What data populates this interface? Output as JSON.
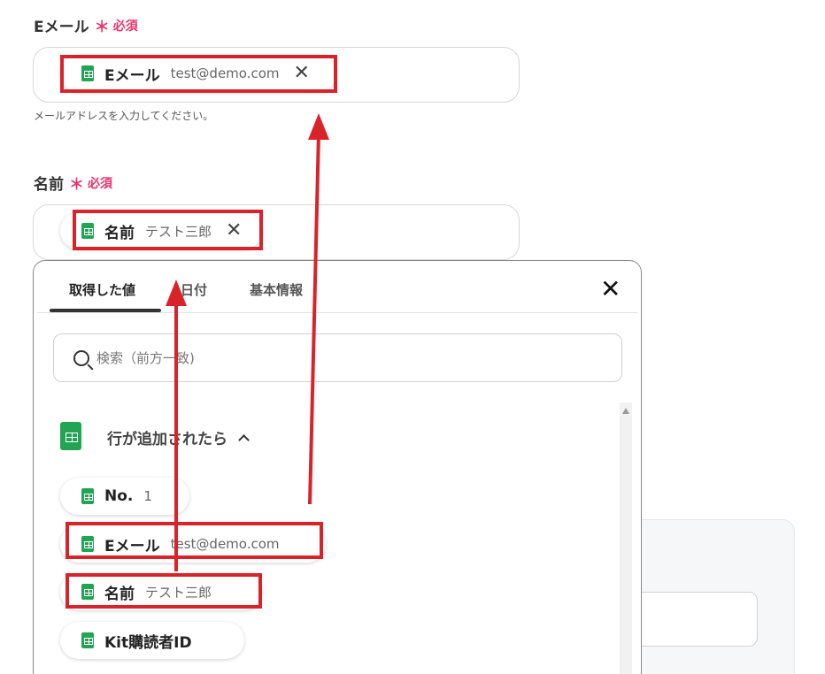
{
  "email_field": {
    "label": "Eメール",
    "required_mark": "＊",
    "required_text": "必須",
    "chip_label": "Eメール",
    "chip_value": "test@demo.com",
    "hint": "メールアドレスを入力してください。"
  },
  "name_field": {
    "label": "名前",
    "required_mark": "＊",
    "required_text": "必須",
    "chip_label": "名前",
    "chip_value": "テスト三郎"
  },
  "panel": {
    "tabs": [
      "取得した値",
      "日付",
      "基本情報"
    ],
    "active_tab": "取得した値",
    "search_placeholder": "検索（前方一致)",
    "group_title": "行が追加されたら",
    "items": [
      {
        "label": "No.",
        "value": "1"
      },
      {
        "label": "Eメール",
        "value": "test@demo.com"
      },
      {
        "label": "名前",
        "value": "テスト三郎"
      },
      {
        "label": "Kit購読者ID",
        "value": ""
      }
    ]
  },
  "colors": {
    "required": "#e8336b",
    "highlight": "#d9232a",
    "sheet_icon": "#23a455"
  },
  "icons": {
    "sheet": "google-sheets-icon",
    "close": "close-icon",
    "search": "search-icon",
    "collapse": "chevron-up-icon"
  }
}
